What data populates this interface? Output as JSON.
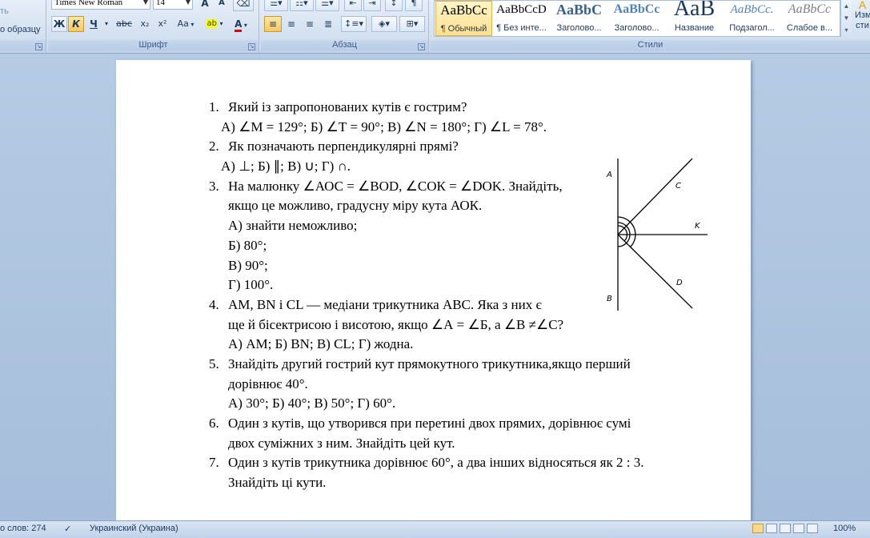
{
  "ribbon": {
    "clipboard": {
      "partial_top": "ть",
      "format_painter_label": "о образцу"
    },
    "font_group": {
      "label": "Шрифт",
      "font_name": "Times New Roman",
      "font_size": "14",
      "bold": "Ж",
      "italic": "К",
      "underline": "Ч",
      "strikethrough": "abc",
      "subscript": "x₂",
      "superscript": "x²",
      "change_case": "Aa",
      "grow_font": "A",
      "shrink_font": "A",
      "highlight": "ab",
      "font_color": "A"
    },
    "paragraph_group": {
      "label": "Абзац"
    },
    "styles_group": {
      "label": "Стили",
      "items": [
        {
          "sample": "AaBbCc",
          "name": "¶ Обычный"
        },
        {
          "sample": "AaBbCcD",
          "name": "¶ Без инте..."
        },
        {
          "sample": "AaBbC",
          "name": "Заголово..."
        },
        {
          "sample": "AaBbCc",
          "name": "Заголово..."
        },
        {
          "sample": "AaB",
          "name": "Название"
        },
        {
          "sample": "AaBbCc.",
          "name": "Подзагол..."
        },
        {
          "sample": "AaBbCc",
          "name": "Слабое в..."
        }
      ],
      "change_styles_line1": "Изм",
      "change_styles_line2": "сти"
    }
  },
  "document": {
    "lines": [
      {
        "type": "q",
        "num": "1.",
        "text": "Який із запропонованих кутів є гострим?"
      },
      {
        "type": "opt",
        "text": "А) ∠М = 129°;  Б) ∠Т = 90°;  В) ∠N = 180°;  Г) ∠L = 78°."
      },
      {
        "type": "q",
        "num": "2.",
        "text": "Як позначають перпендикулярні прямі?"
      },
      {
        "type": "opt",
        "text": "А) ⊥;   Б) ∥;   В) ∪;  Г) ∩."
      },
      {
        "type": "q",
        "num": "3.",
        "text": "На малюнку ∠АОС = ∠ВОD, ∠СОК = ∠DOK. Знайдіть,"
      },
      {
        "type": "cont",
        "text": "якщо це можливо, градусну міру кута АОК."
      },
      {
        "type": "cont",
        "text": "А) знайти неможливо;"
      },
      {
        "type": "cont",
        "text": "Б) 80°;"
      },
      {
        "type": "cont",
        "text": "В) 90°;"
      },
      {
        "type": "cont",
        "text": "Г) 100°."
      },
      {
        "type": "q",
        "num": "4.",
        "text": "АМ, ВN і CL — медіани трикутника АВС. Яка з них є"
      },
      {
        "type": "cont",
        "text": "ще й бісектрисою і висотою, якщо ∠А = ∠Б, а ∠В ≠∠С?"
      },
      {
        "type": "cont",
        "text": "А) АМ;  Б) ВN;  В) CL;  Г) жодна."
      },
      {
        "type": "q",
        "num": "5.",
        "text": "Знайдіть другий гострий кут прямокутного трикутника,якщо перший"
      },
      {
        "type": "cont",
        "text": "дорівнює 40°."
      },
      {
        "type": "cont",
        "text": "А) 30°;  Б) 40°;  В) 50°;  Г) 60°."
      },
      {
        "type": "q",
        "num": "6.",
        "text": "Один з кутів, що утворився при перетині двох прямих, дорівнює сумі"
      },
      {
        "type": "cont",
        "text": "двох суміжних з ним. Знайдіть цей кут."
      },
      {
        "type": "q",
        "num": "7.",
        "text": "Один з кутів трикутника дорівнює 60°, а два інших відносяться як 2 : 3."
      },
      {
        "type": "cont",
        "text": "Знайдіть ці кути."
      }
    ],
    "figure_labels": {
      "a": "A",
      "b": "B",
      "c": "C",
      "k": "K",
      "d": "D"
    }
  },
  "statusbar": {
    "word_count": "о слов: 274",
    "language": "Украинский (Украина)",
    "zoom": "100%"
  }
}
